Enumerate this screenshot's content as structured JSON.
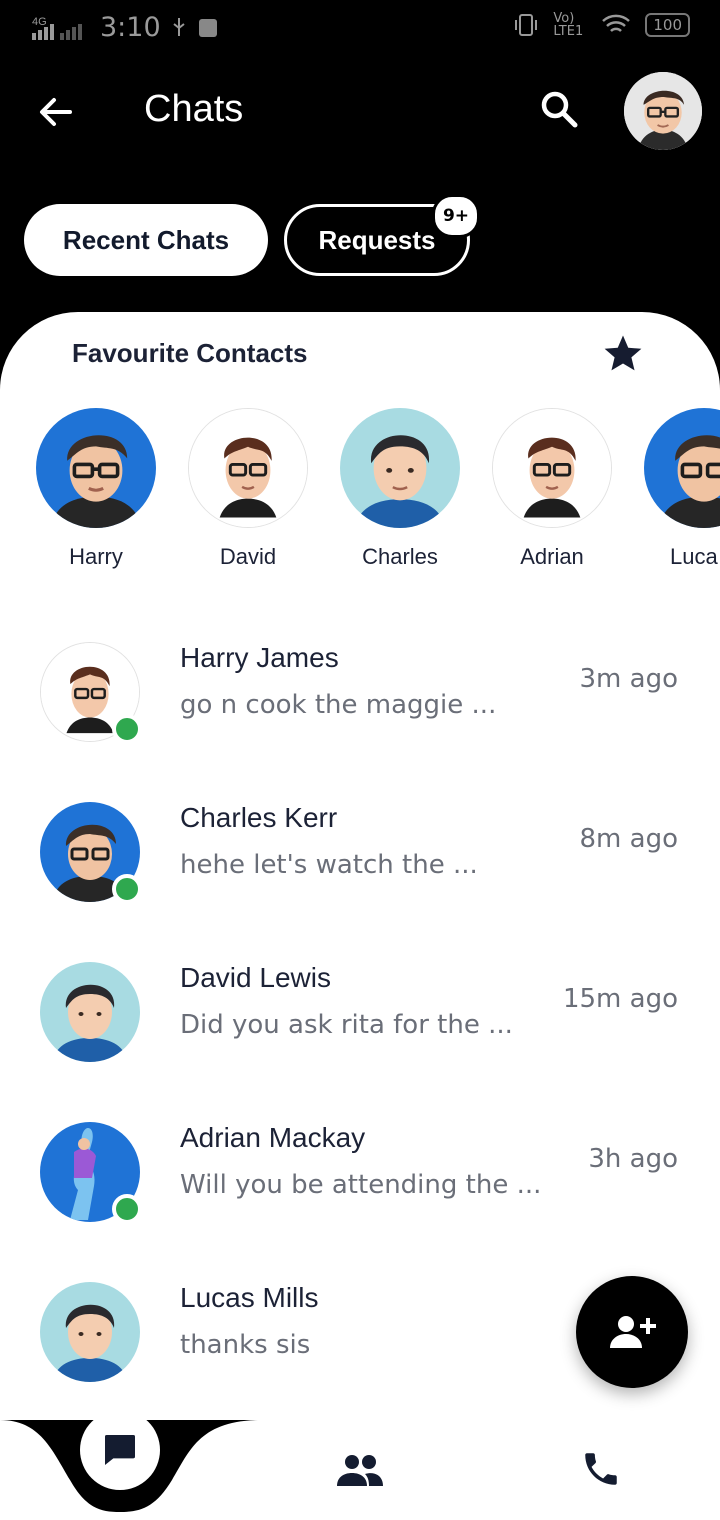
{
  "status_bar": {
    "network": "4G",
    "time": "3:10",
    "lte": "Vo) LTE1",
    "battery": "100"
  },
  "header": {
    "title": "Chats"
  },
  "tabs": [
    {
      "label": "Recent Chats"
    },
    {
      "label": "Requests"
    }
  ],
  "requests_badge": "9+",
  "favourites": {
    "title": "Favourite Contacts",
    "contacts": [
      {
        "name": "Harry"
      },
      {
        "name": "David"
      },
      {
        "name": "Charles"
      },
      {
        "name": "Adrian"
      },
      {
        "name": "Luca"
      }
    ]
  },
  "chats": [
    {
      "name": "Harry James",
      "message": "go n cook the maggie ...",
      "time": "3m ago",
      "online": true
    },
    {
      "name": "Charles Kerr",
      "message": "hehe let's watch the ...",
      "time": "8m ago",
      "online": true
    },
    {
      "name": "David Lewis",
      "message": "Did you ask rita for the ...",
      "time": "15m ago",
      "online": false
    },
    {
      "name": "Adrian Mackay",
      "message": "Will you be attending the ...",
      "time": "3h ago",
      "online": true
    },
    {
      "name": "Lucas Mills",
      "message": "thanks sis",
      "time": "",
      "online": false
    }
  ],
  "colors": {
    "accent": "#000000",
    "text_dark": "#1c2236",
    "online": "#2fa84f",
    "avatar_blue": "#1f73d6",
    "avatar_teal": "#a8dbe2"
  },
  "icons": [
    "back-arrow-icon",
    "search-icon",
    "star-icon",
    "add-person-icon",
    "chat-bubble-icon",
    "people-icon",
    "phone-icon"
  ]
}
